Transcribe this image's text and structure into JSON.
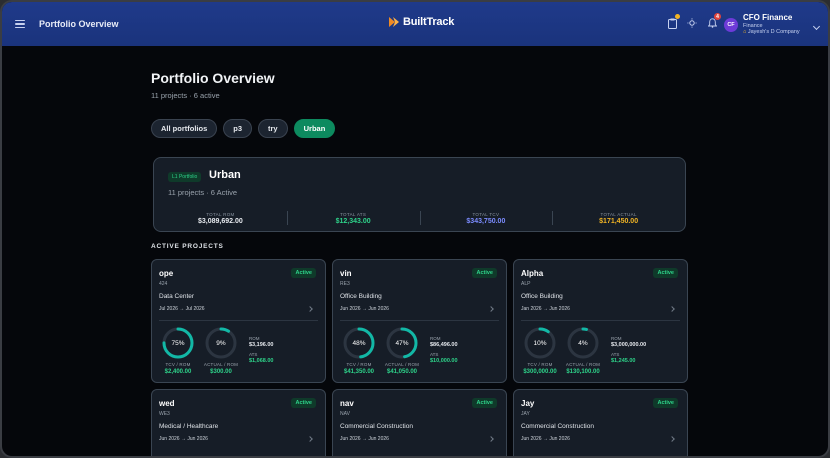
{
  "topbar": {
    "title": "Portfolio Overview",
    "brand": "BuiltTrack",
    "notif_count": "4"
  },
  "user": {
    "initials": "CF",
    "name": "CFO Finance",
    "role": "Finance",
    "company": "Jayesh's D Company"
  },
  "page": {
    "title": "Portfolio Overview",
    "subtitle": "11 projects · 6 active"
  },
  "chips": [
    "All portfolios",
    "p3",
    "try",
    "Urban"
  ],
  "active_chip": "Urban",
  "summary": {
    "level": "L1 Portfolio",
    "name": "Urban",
    "sub": "11 projects · 6 Active",
    "stats": [
      {
        "label": "TOTAL ROM",
        "value": "$3,089,692.00",
        "color": "#e6e9ee"
      },
      {
        "label": "TOTAL ATS",
        "value": "$12,343.00",
        "color": "#2ed38a"
      },
      {
        "label": "TOTAL TCV",
        "value": "$343,750.00",
        "color": "#7c8cff"
      },
      {
        "label": "TOTAL ACTUAL",
        "value": "$171,450.00",
        "color": "#f2b524"
      }
    ]
  },
  "section_title": "ACTIVE PROJECTS",
  "projects": [
    {
      "name": "ope",
      "code": "424",
      "status": "Active",
      "type": "Data Center",
      "dates": "Jul 2026 → Jul 2026",
      "tcv_pct": "75%",
      "tcv_fraction": 0.75,
      "actual_pct": "9%",
      "actual_fraction": 0.09,
      "tcv_label": "TCV / ROM",
      "actual_label": "ACTUAL / ROM",
      "tcv_value": "$2,400.00",
      "actual_value": "$300.00",
      "rom_label": "ROM",
      "rom_value": "$3,196.00",
      "ats_label": "ATS",
      "ats_value": "$1,068.00"
    },
    {
      "name": "vin",
      "code": "RE3",
      "status": "Active",
      "type": "Office Building",
      "dates": "Jun 2026 → Jun 2026",
      "tcv_pct": "48%",
      "tcv_fraction": 0.48,
      "actual_pct": "47%",
      "actual_fraction": 0.47,
      "tcv_label": "TCV / ROM",
      "actual_label": "ACTUAL / ROM",
      "tcv_value": "$41,350.00",
      "actual_value": "$41,050.00",
      "rom_label": "ROM",
      "rom_value": "$86,496.00",
      "ats_label": "ATS",
      "ats_value": "$10,000.00"
    },
    {
      "name": "Alpha",
      "code": "ALP",
      "status": "Active",
      "type": "Office Building",
      "dates": "Jan 2026 → Jun 2026",
      "tcv_pct": "10%",
      "tcv_fraction": 0.1,
      "actual_pct": "4%",
      "actual_fraction": 0.04,
      "tcv_label": "TCV / ROM",
      "actual_label": "ACTUAL / ROM",
      "tcv_value": "$300,000.00",
      "actual_value": "$130,100.00",
      "rom_label": "ROM",
      "rom_value": "$3,000,000.00",
      "ats_label": "ATS",
      "ats_value": "$1,245.00"
    },
    {
      "name": "wed",
      "code": "WE3",
      "status": "Active",
      "type": "Medical / Healthcare",
      "dates": "Jun 2026 → Jun 2026"
    },
    {
      "name": "nav",
      "code": "NAV",
      "status": "Active",
      "type": "Commercial Construction",
      "dates": "Jun 2026 → Jun 2026"
    },
    {
      "name": "Jay",
      "code": "JAY",
      "status": "Active",
      "type": "Commercial Construction",
      "dates": "Jun 2026 → Jun 2026"
    }
  ],
  "colors": {
    "accent": "#0d8a5f",
    "ring": "#12b8a6",
    "ring_track": "#2c3541",
    "green": "#2ed38a"
  }
}
